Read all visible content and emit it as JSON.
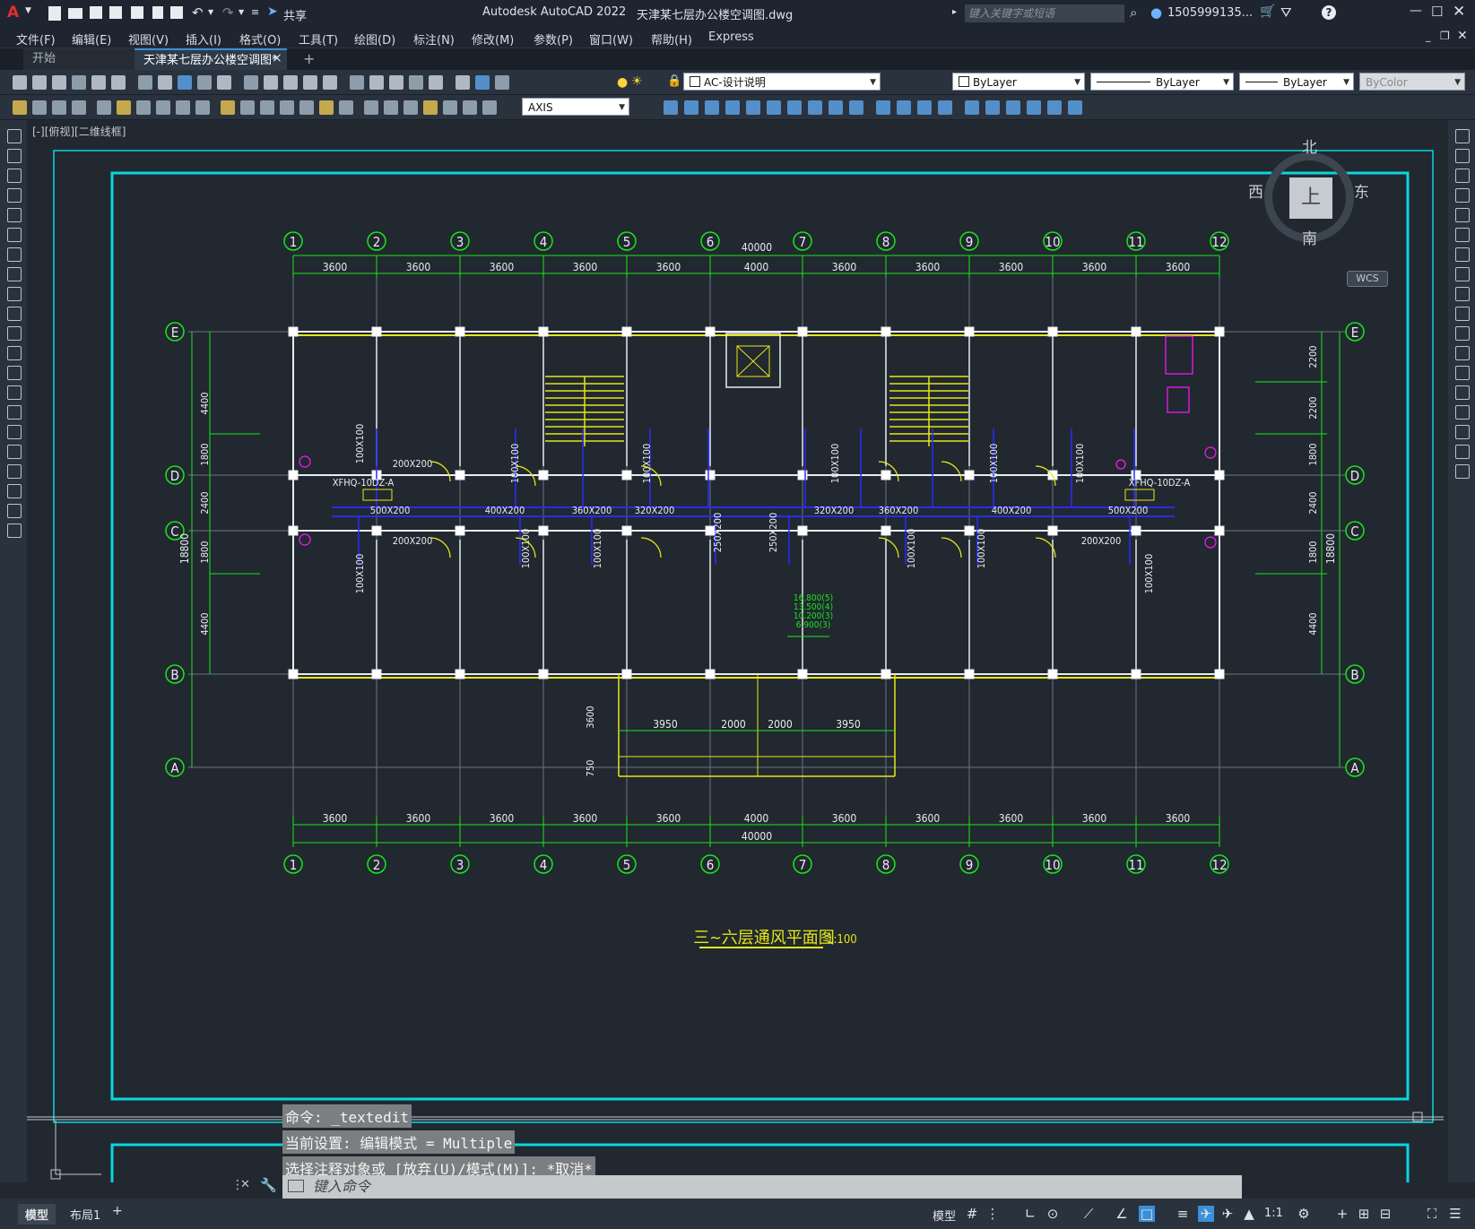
{
  "titlebar": {
    "app_title": "Autodesk AutoCAD 2022",
    "file_name": "天津某七层办公楼空调图.dwg",
    "share_label": "共享",
    "search_placeholder": "键入关键字或短语",
    "user": "1505999135...",
    "logo_letter": "A"
  },
  "menu": [
    "文件(F)",
    "编辑(E)",
    "视图(V)",
    "插入(I)",
    "格式(O)",
    "工具(T)",
    "绘图(D)",
    "标注(N)",
    "修改(M)",
    "参数(P)",
    "窗口(W)",
    "帮助(H)",
    "Express"
  ],
  "tabs": {
    "start": "开始",
    "doc": "天津某七层办公楼空调图*",
    "close": "×",
    "add": "+"
  },
  "toolbar": {
    "layer": "AC-设计说明",
    "color": "ByLayer",
    "linetype": "ByLayer",
    "lineweight": "ByLayer",
    "plotstyle": "ByColor",
    "dimstyle": "AXIS"
  },
  "viewport_label": "[-][俯视][二维线框]",
  "viewcube": {
    "north": "北",
    "south": "南",
    "east": "东",
    "west": "西",
    "top": "上",
    "wcs": "WCS"
  },
  "drawing": {
    "axis_numbers": [
      "1",
      "2",
      "3",
      "4",
      "5",
      "6",
      "7",
      "8",
      "9",
      "10",
      "11",
      "12"
    ],
    "axis_letters": [
      "E",
      "D",
      "C",
      "B",
      "A"
    ],
    "total_width": "40000",
    "bay_dims": [
      "3600",
      "3600",
      "3600",
      "3600",
      "3600",
      "4000",
      "3600",
      "3600",
      "3600",
      "3600",
      "3600"
    ],
    "left_dims": [
      "4400",
      "1800",
      "2400",
      "1800",
      "4400"
    ],
    "left_total": "18800",
    "right_dims": [
      "2200",
      "2200",
      "1800",
      "2400",
      "1800",
      "4400"
    ],
    "right_total": "18800",
    "entrance_dims": [
      "3950",
      "2000",
      "2000",
      "3950"
    ],
    "entrance_vert": [
      "3600",
      "750"
    ],
    "ducts": [
      "500X200",
      "400X200",
      "360X200",
      "320X200",
      "320X200",
      "360X200",
      "400X200",
      "500X200",
      "200X200",
      "200X200",
      "200X200",
      "200X200",
      "100X100",
      "250X200",
      "250X200"
    ],
    "units": [
      "XFHQ-10DZ-A",
      "XFHQ-10DZ-A"
    ],
    "elevations": [
      "16.800(5)",
      "13.500(4)",
      "10.200(3)",
      "6.900(3)"
    ],
    "title": "三~六层通风平面图",
    "scale": "1:100"
  },
  "command": {
    "lines": [
      "命令: _textedit",
      "当前设置: 编辑模式 = Multiple",
      "选择注释对象或 [放弃(U)/模式(M)]: *取消*"
    ],
    "placeholder": "键入命令"
  },
  "statusbar": {
    "model_tab": "模型",
    "layout_tab": "布局1",
    "add": "+",
    "model_btn": "模型",
    "scale": "1:1"
  }
}
